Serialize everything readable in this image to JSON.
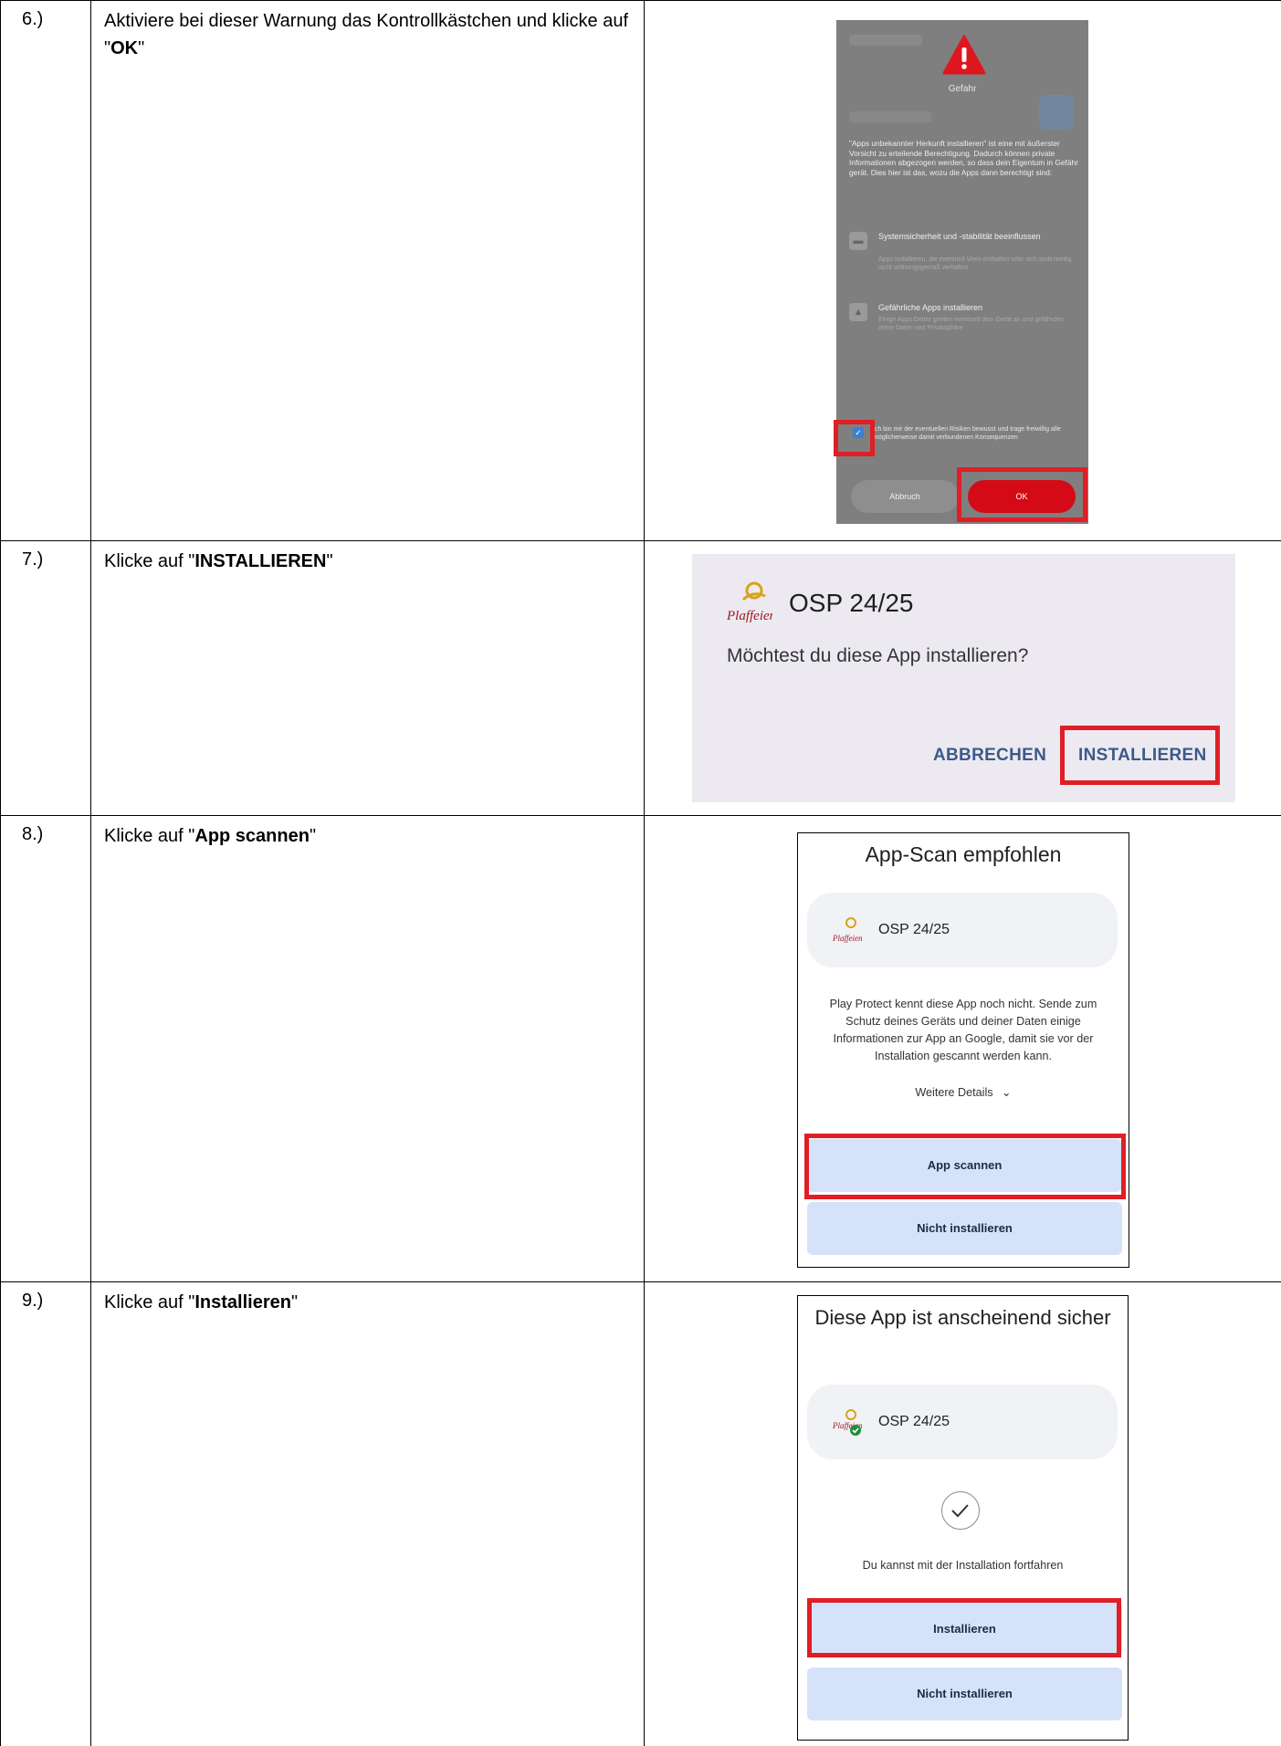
{
  "rows": [
    {
      "number": "6.)",
      "instruction_prefix": "Aktiviere bei dieser Warnung das Kontrollkästchen und klicke auf \"",
      "instruction_bold": "OK",
      "instruction_suffix": "\"",
      "screen": {
        "heading": "Gefahr",
        "paragraph": "\"Apps unbekannter Herkunft installieren\" ist eine mit äußerster Vorsicht zu erteilende Berechtigung. Dadurch können private Informationen abgezogen werden, so dass dein Eigentum in Gefähr gerät. Dies hier ist das, wozu die Apps dann berechtigt sind:",
        "items": [
          {
            "title": "Systemsicherheit und -stabilität beeinflussen",
            "desc": "Apps installieren, die eventuell Viren enthalten oder sich anderweitig nicht ordnungsgemäß verhalten",
            "icon": "lock-icon"
          },
          {
            "title": "Gefährliche Apps installieren",
            "desc": "Einige Apps Dritter greifen eventuell dein Gerät an und gefährden deine Daten und Privatsphäre",
            "icon": "warning-icon"
          }
        ],
        "consent": "Ich bin mir der eventuellen Risiken bewusst und trage freiwillig alle möglicherweise damit verbundenen Konsequenzen",
        "cancel_label": "Abbruch",
        "ok_label": "OK"
      }
    },
    {
      "number": "7.)",
      "instruction_prefix": "Klicke auf \"",
      "instruction_bold": "INSTALLIEREN",
      "instruction_suffix": "\"",
      "screen": {
        "logo_text": "Plaffeien",
        "app_name": "OSP 24/25",
        "question": "Möchtest du diese App installieren?",
        "cancel_label": "ABBRECHEN",
        "install_label": "INSTALLIEREN"
      }
    },
    {
      "number": "8.)",
      "instruction_prefix": "Klicke auf \"",
      "instruction_bold": "App scannen",
      "instruction_suffix": "\"",
      "screen": {
        "title": "App-Scan empfohlen",
        "app_name": "OSP 24/25",
        "description": "Play Protect kennt diese App noch nicht. Sende zum Schutz deines Geräts und deiner Daten einige Informationen zur App an Google, damit sie vor der Installation gescannt werden kann.",
        "more_label": "Weitere Details",
        "scan_label": "App scannen",
        "dont_install_label": "Nicht installieren"
      }
    },
    {
      "number": "9.)",
      "instruction_prefix": "Klicke auf \"",
      "instruction_bold": "Installieren",
      "instruction_suffix": "\"",
      "screen": {
        "title": "Diese App ist anscheinend sicher",
        "app_name": "OSP 24/25",
        "continue_text": "Du kannst mit der Installation fortfahren",
        "install_label": "Installieren",
        "dont_install_label": "Nicht installieren"
      }
    }
  ],
  "colors": {
    "highlight": "#e01e25",
    "danger": "#d40b16",
    "button_blue": "#d5e2fa",
    "link_blue": "#3b5a8a"
  }
}
